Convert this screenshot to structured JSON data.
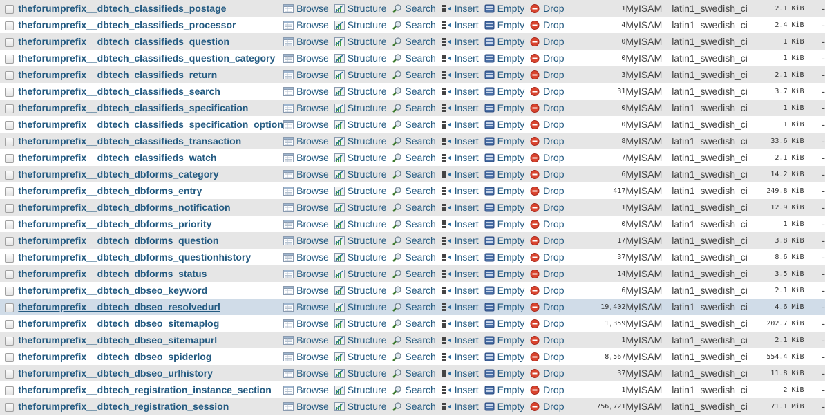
{
  "actions": {
    "browse": "Browse",
    "structure": "Structure",
    "search": "Search",
    "insert": "Insert",
    "empty": "Empty",
    "drop": "Drop"
  },
  "colors": {
    "link": "#235a81",
    "row_odd": "#e6e6e6",
    "row_even": "#ffffff",
    "row_hover": "#d0dce8",
    "drop_red": "#d9442e"
  },
  "tables": [
    {
      "name": "theforumprefix__dbtech_classifieds_postage",
      "rows": "1",
      "engine": "MyISAM",
      "collation": "latin1_swedish_ci",
      "size": "2.1 KiB",
      "overhead": "-"
    },
    {
      "name": "theforumprefix__dbtech_classifieds_processor",
      "rows": "4",
      "engine": "MyISAM",
      "collation": "latin1_swedish_ci",
      "size": "2.4 KiB",
      "overhead": "-"
    },
    {
      "name": "theforumprefix__dbtech_classifieds_question",
      "rows": "0",
      "engine": "MyISAM",
      "collation": "latin1_swedish_ci",
      "size": "1 KiB",
      "overhead": "-"
    },
    {
      "name": "theforumprefix__dbtech_classifieds_question_category",
      "rows": "0",
      "engine": "MyISAM",
      "collation": "latin1_swedish_ci",
      "size": "1 KiB",
      "overhead": "-"
    },
    {
      "name": "theforumprefix__dbtech_classifieds_return",
      "rows": "3",
      "engine": "MyISAM",
      "collation": "latin1_swedish_ci",
      "size": "2.1 KiB",
      "overhead": "-"
    },
    {
      "name": "theforumprefix__dbtech_classifieds_search",
      "rows": "31",
      "engine": "MyISAM",
      "collation": "latin1_swedish_ci",
      "size": "3.7 KiB",
      "overhead": "-"
    },
    {
      "name": "theforumprefix__dbtech_classifieds_specification",
      "rows": "0",
      "engine": "MyISAM",
      "collation": "latin1_swedish_ci",
      "size": "1 KiB",
      "overhead": "-"
    },
    {
      "name": "theforumprefix__dbtech_classifieds_specification_option",
      "rows": "0",
      "engine": "MyISAM",
      "collation": "latin1_swedish_ci",
      "size": "1 KiB",
      "overhead": "-"
    },
    {
      "name": "theforumprefix__dbtech_classifieds_transaction",
      "rows": "8",
      "engine": "MyISAM",
      "collation": "latin1_swedish_ci",
      "size": "33.6 KiB",
      "overhead": "-"
    },
    {
      "name": "theforumprefix__dbtech_classifieds_watch",
      "rows": "7",
      "engine": "MyISAM",
      "collation": "latin1_swedish_ci",
      "size": "2.1 KiB",
      "overhead": "-"
    },
    {
      "name": "theforumprefix__dbtech_dbforms_category",
      "rows": "6",
      "engine": "MyISAM",
      "collation": "latin1_swedish_ci",
      "size": "14.2 KiB",
      "overhead": "-"
    },
    {
      "name": "theforumprefix__dbtech_dbforms_entry",
      "rows": "417",
      "engine": "MyISAM",
      "collation": "latin1_swedish_ci",
      "size": "249.8 KiB",
      "overhead": "-"
    },
    {
      "name": "theforumprefix__dbtech_dbforms_notification",
      "rows": "1",
      "engine": "MyISAM",
      "collation": "latin1_swedish_ci",
      "size": "12.9 KiB",
      "overhead": "-"
    },
    {
      "name": "theforumprefix__dbtech_dbforms_priority",
      "rows": "0",
      "engine": "MyISAM",
      "collation": "latin1_swedish_ci",
      "size": "1 KiB",
      "overhead": "-"
    },
    {
      "name": "theforumprefix__dbtech_dbforms_question",
      "rows": "17",
      "engine": "MyISAM",
      "collation": "latin1_swedish_ci",
      "size": "3.8 KiB",
      "overhead": "-"
    },
    {
      "name": "theforumprefix__dbtech_dbforms_questionhistory",
      "rows": "37",
      "engine": "MyISAM",
      "collation": "latin1_swedish_ci",
      "size": "8.6 KiB",
      "overhead": "-"
    },
    {
      "name": "theforumprefix__dbtech_dbforms_status",
      "rows": "14",
      "engine": "MyISAM",
      "collation": "latin1_swedish_ci",
      "size": "3.5 KiB",
      "overhead": "-"
    },
    {
      "name": "theforumprefix__dbtech_dbseo_keyword",
      "rows": "6",
      "engine": "MyISAM",
      "collation": "latin1_swedish_ci",
      "size": "2.1 KiB",
      "overhead": "-"
    },
    {
      "name": "theforumprefix__dbtech_dbseo_resolvedurl",
      "rows": "19,402",
      "engine": "MyISAM",
      "collation": "latin1_swedish_ci",
      "size": "4.6 MiB",
      "overhead": "-",
      "hover": true
    },
    {
      "name": "theforumprefix__dbtech_dbseo_sitemaplog",
      "rows": "1,359",
      "engine": "MyISAM",
      "collation": "latin1_swedish_ci",
      "size": "202.7 KiB",
      "overhead": "-"
    },
    {
      "name": "theforumprefix__dbtech_dbseo_sitemapurl",
      "rows": "1",
      "engine": "MyISAM",
      "collation": "latin1_swedish_ci",
      "size": "2.1 KiB",
      "overhead": "-"
    },
    {
      "name": "theforumprefix__dbtech_dbseo_spiderlog",
      "rows": "8,567",
      "engine": "MyISAM",
      "collation": "latin1_swedish_ci",
      "size": "554.4 KiB",
      "overhead": "-"
    },
    {
      "name": "theforumprefix__dbtech_dbseo_urlhistory",
      "rows": "37",
      "engine": "MyISAM",
      "collation": "latin1_swedish_ci",
      "size": "11.8 KiB",
      "overhead": "-"
    },
    {
      "name": "theforumprefix__dbtech_registration_instance_section",
      "rows": "1",
      "engine": "MyISAM",
      "collation": "latin1_swedish_ci",
      "size": "2 KiB",
      "overhead": "-"
    },
    {
      "name": "theforumprefix__dbtech_registration_session",
      "rows": "756,721",
      "engine": "MyISAM",
      "collation": "latin1_swedish_ci",
      "size": "71.1 MiB",
      "overhead": "-"
    }
  ]
}
